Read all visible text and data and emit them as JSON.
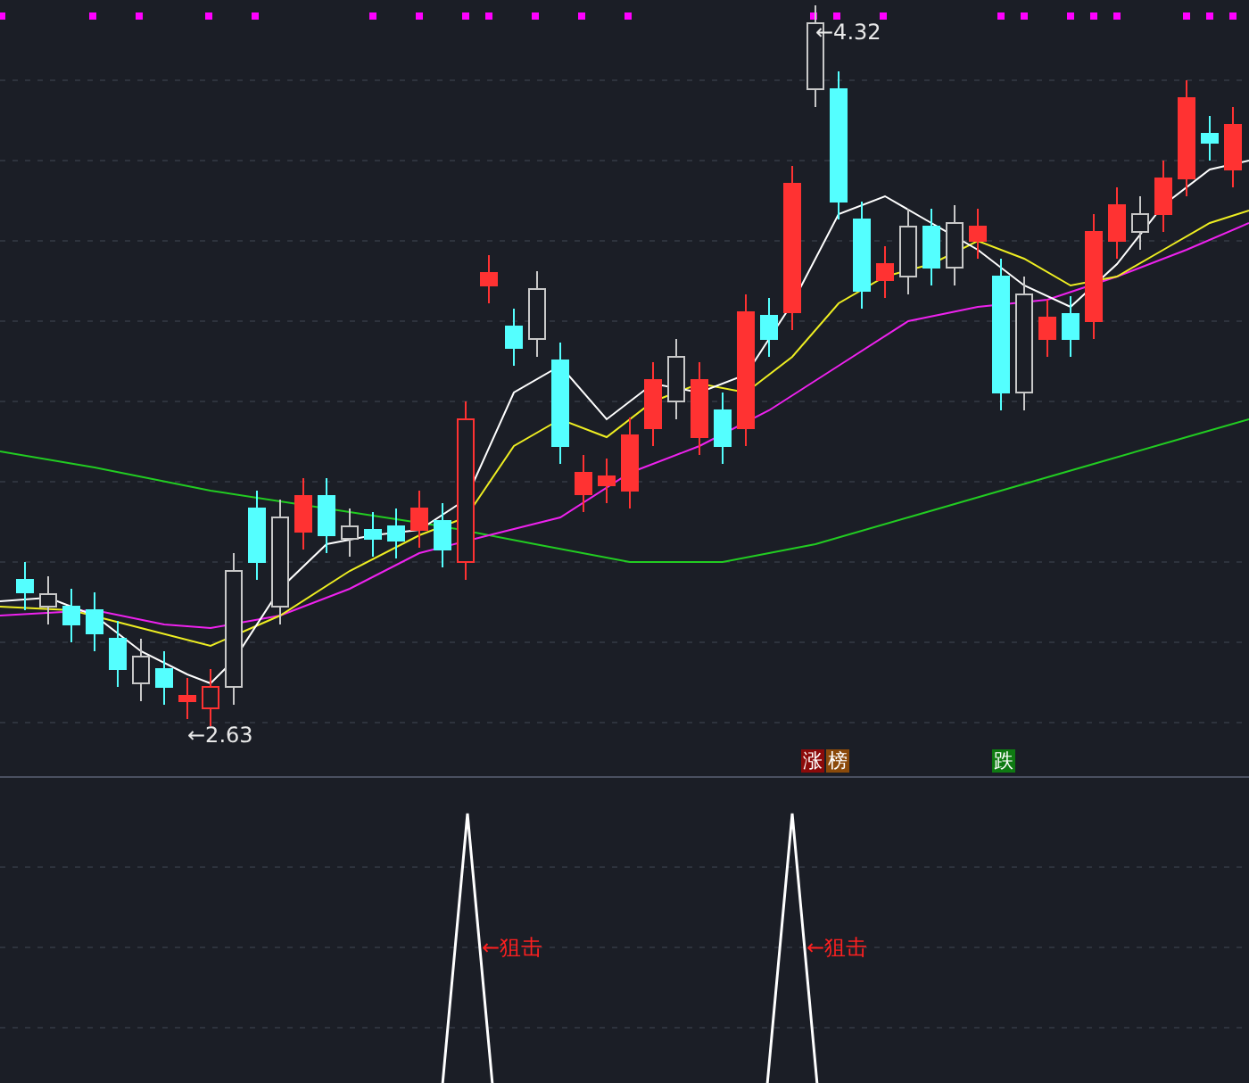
{
  "main_chart": {
    "high_label": "←4.32",
    "low_label": "←2.63",
    "badges": [
      {
        "text": "涨",
        "color": "#8b0a0a"
      },
      {
        "text": "榜",
        "color": "#8b4a0a"
      },
      {
        "text": "跌",
        "color": "#0f7a12"
      }
    ]
  },
  "signal_panel": {
    "signals": [
      {
        "label": "←狙击"
      },
      {
        "label": "←狙击"
      }
    ]
  }
}
